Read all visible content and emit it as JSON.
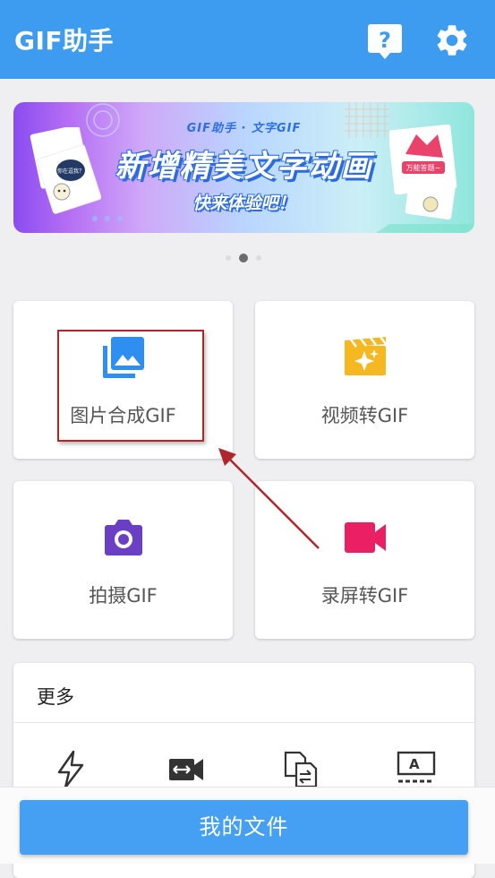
{
  "app": {
    "title": "GIF助手"
  },
  "banner": {
    "subtitle": "GIF助手 · 文字GIF",
    "headline": "新增精美文字动画",
    "tagline": "快来体验吧！",
    "sticker_left_text": "你在逗我？",
    "sticker_right_text": "万能答题~"
  },
  "tiles": [
    {
      "label": "图片合成GIF",
      "icon": "image-stack-icon",
      "color": "#2f8ff0"
    },
    {
      "label": "视频转GIF",
      "icon": "movie-sparkle-icon",
      "color": "#f5b820"
    },
    {
      "label": "拍摄GIF",
      "icon": "camera-icon",
      "color": "#6b3fc3"
    },
    {
      "label": "录屏转GIF",
      "icon": "video-camera-icon",
      "color": "#ea1f64"
    }
  ],
  "more": {
    "title": "更多",
    "icons": [
      "flash-icon",
      "video-resize-icon",
      "file-convert-icon",
      "text-frame-icon"
    ]
  },
  "bottom": {
    "files_label": "我的文件"
  },
  "colors": {
    "primary": "#3d9cf0",
    "annotation": "#b0262b"
  }
}
